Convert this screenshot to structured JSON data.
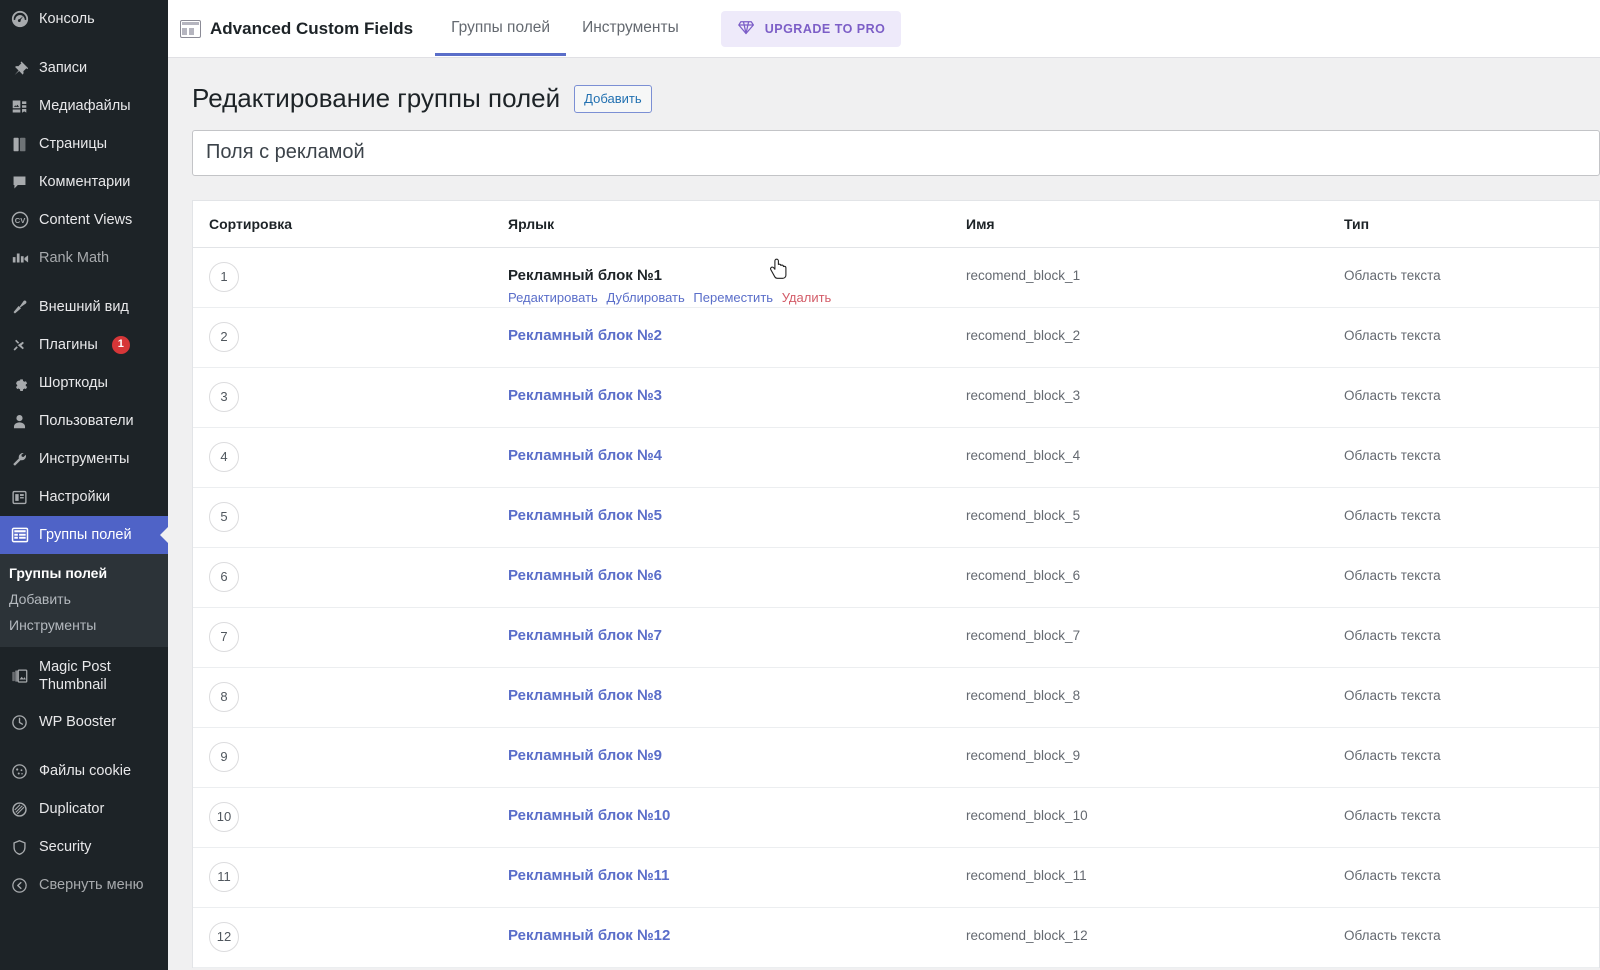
{
  "sidebar": {
    "items": [
      {
        "label": "Консоль",
        "icon": "dashboard-icon",
        "state": "normal"
      },
      {
        "label": "Записи",
        "icon": "pin-icon",
        "state": "normal"
      },
      {
        "label": "Медиафайлы",
        "icon": "media-icon",
        "state": "normal"
      },
      {
        "label": "Страницы",
        "icon": "pages-icon",
        "state": "normal"
      },
      {
        "label": "Комментарии",
        "icon": "comments-icon",
        "state": "normal"
      },
      {
        "label": "Content Views",
        "icon": "content-views-icon",
        "state": "normal"
      },
      {
        "label": "Rank Math",
        "icon": "rank-math-icon",
        "state": "dim"
      },
      {
        "label": "Внешний вид",
        "icon": "appearance-icon",
        "state": "normal"
      },
      {
        "label": "Плагины",
        "icon": "plugins-icon",
        "state": "normal",
        "badge": "1"
      },
      {
        "label": "Шорткоды",
        "icon": "gear-icon",
        "state": "normal"
      },
      {
        "label": "Пользователи",
        "icon": "users-icon",
        "state": "normal"
      },
      {
        "label": "Инструменты",
        "icon": "wrench-icon",
        "state": "normal"
      },
      {
        "label": "Настройки",
        "icon": "settings-icon",
        "state": "normal"
      },
      {
        "label": "Группы полей",
        "icon": "field-groups-icon",
        "state": "active"
      }
    ],
    "submenu": [
      {
        "label": "Группы полей",
        "current": true
      },
      {
        "label": "Добавить",
        "current": false
      },
      {
        "label": "Инструменты",
        "current": false
      }
    ],
    "items_bottom": [
      {
        "label": "Magic Post Thumbnail",
        "icon": "images-icon",
        "state": "normal"
      },
      {
        "label": "WP Booster",
        "icon": "clock-icon",
        "state": "normal"
      },
      {
        "label": "Файлы cookie",
        "icon": "cookie-icon",
        "state": "normal"
      },
      {
        "label": "Duplicator",
        "icon": "duplicator-icon",
        "state": "normal"
      },
      {
        "label": "Security",
        "icon": "shield-icon",
        "state": "normal"
      },
      {
        "label": "Свернуть меню",
        "icon": "collapse-icon",
        "state": "dim"
      }
    ]
  },
  "acf_header": {
    "brand": "Advanced Custom Fields",
    "brand_icon": "acf-logo-icon",
    "tabs": [
      {
        "label": "Группы полей",
        "active": true
      },
      {
        "label": "Инструменты",
        "active": false
      }
    ],
    "upgrade_label": "UPGRADE TO PRO",
    "upgrade_icon": "diamond-icon"
  },
  "page": {
    "title": "Редактирование группы полей",
    "add_new_label": "Добавить",
    "group_title_value": "Поля с рекламой"
  },
  "fields_table": {
    "columns": [
      "Сортировка",
      "Ярлык",
      "Имя",
      "Тип"
    ],
    "rows": [
      {
        "order": "1",
        "label": "Рекламный блок №1",
        "name": "recomend_block_1",
        "type": "Область текста"
      },
      {
        "order": "2",
        "label": "Рекламный блок №2",
        "name": "recomend_block_2",
        "type": "Область текста"
      },
      {
        "order": "3",
        "label": "Рекламный блок №3",
        "name": "recomend_block_3",
        "type": "Область текста"
      },
      {
        "order": "4",
        "label": "Рекламный блок №4",
        "name": "recomend_block_4",
        "type": "Область текста"
      },
      {
        "order": "5",
        "label": "Рекламный блок №5",
        "name": "recomend_block_5",
        "type": "Область текста"
      },
      {
        "order": "6",
        "label": "Рекламный блок №6",
        "name": "recomend_block_6",
        "type": "Область текста"
      },
      {
        "order": "7",
        "label": "Рекламный блок №7",
        "name": "recomend_block_7",
        "type": "Область текста"
      },
      {
        "order": "8",
        "label": "Рекламный блок №8",
        "name": "recomend_block_8",
        "type": "Область текста"
      },
      {
        "order": "9",
        "label": "Рекламный блок №9",
        "name": "recomend_block_9",
        "type": "Область текста"
      },
      {
        "order": "10",
        "label": "Рекламный блок №10",
        "name": "recomend_block_10",
        "type": "Область текста"
      },
      {
        "order": "11",
        "label": "Рекламный блок №11",
        "name": "recomend_block_11",
        "type": "Область текста"
      },
      {
        "order": "12",
        "label": "Рекламный блок №12",
        "name": "recomend_block_12",
        "type": "Область текста"
      }
    ],
    "row_actions": {
      "edit": "Редактировать",
      "duplicate": "Дублировать",
      "move": "Переместить",
      "delete": "Удалить"
    }
  },
  "colors": {
    "sidebar_bg": "#1d2327",
    "sidebar_submenu_bg": "#2c3338",
    "accent_active": "#4f63c7",
    "link": "#5a6ec9",
    "danger": "#d35c68",
    "badge": "#d63638",
    "upgrade_bg": "#eeeafa",
    "upgrade_text": "#7c5ec7",
    "page_bg": "#f0f0f1"
  }
}
